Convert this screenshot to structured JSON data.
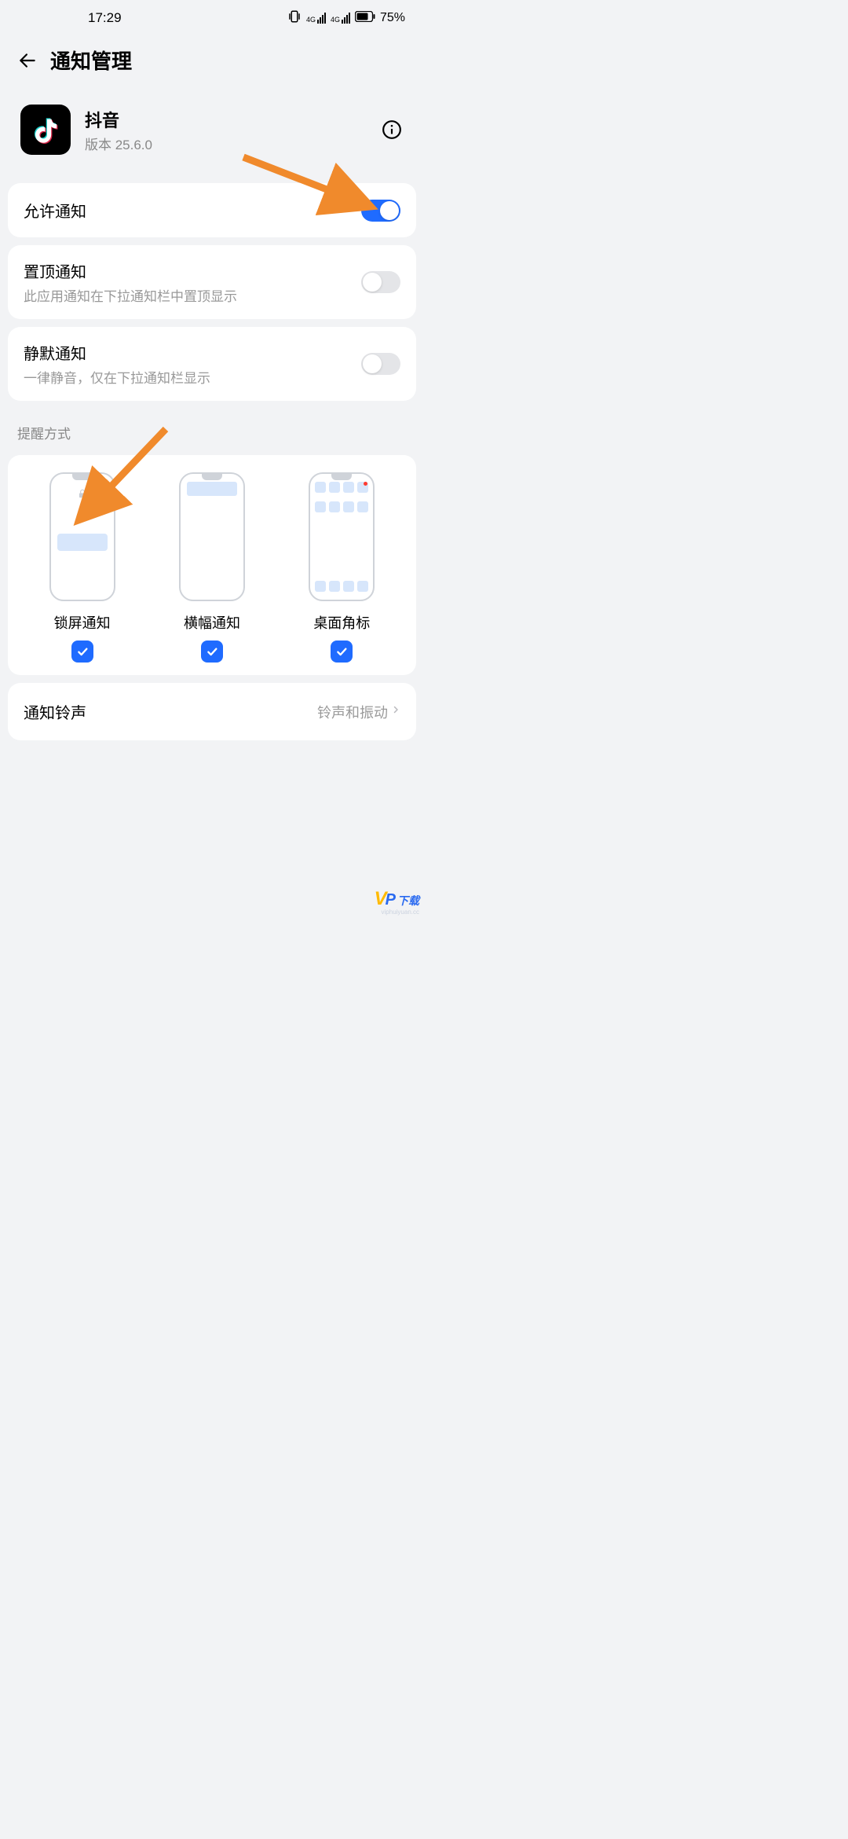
{
  "statusbar": {
    "time": "17:29",
    "network1": "4G",
    "network2": "4G",
    "battery_pct": "75%"
  },
  "header": {
    "title": "通知管理"
  },
  "app": {
    "name": "抖音",
    "version": "版本 25.6.0"
  },
  "rows": {
    "allow": {
      "title": "允许通知",
      "on": true
    },
    "pin": {
      "title": "置顶通知",
      "sub": "此应用通知在下拉通知栏中置顶显示",
      "on": false
    },
    "silent": {
      "title": "静默通知",
      "sub": "一律静音，仅在下拉通知栏显示",
      "on": false
    }
  },
  "section": {
    "reminder_label": "提醒方式"
  },
  "reminder": {
    "items": [
      {
        "label": "锁屏通知",
        "checked": true
      },
      {
        "label": "横幅通知",
        "checked": true
      },
      {
        "label": "桌面角标",
        "checked": true
      }
    ]
  },
  "ringtone": {
    "title": "通知铃声",
    "value": "铃声和振动"
  },
  "watermark": {
    "v": "V",
    "p": "P",
    "cn": "下载",
    "sub": "viphuiyuan.cc"
  }
}
